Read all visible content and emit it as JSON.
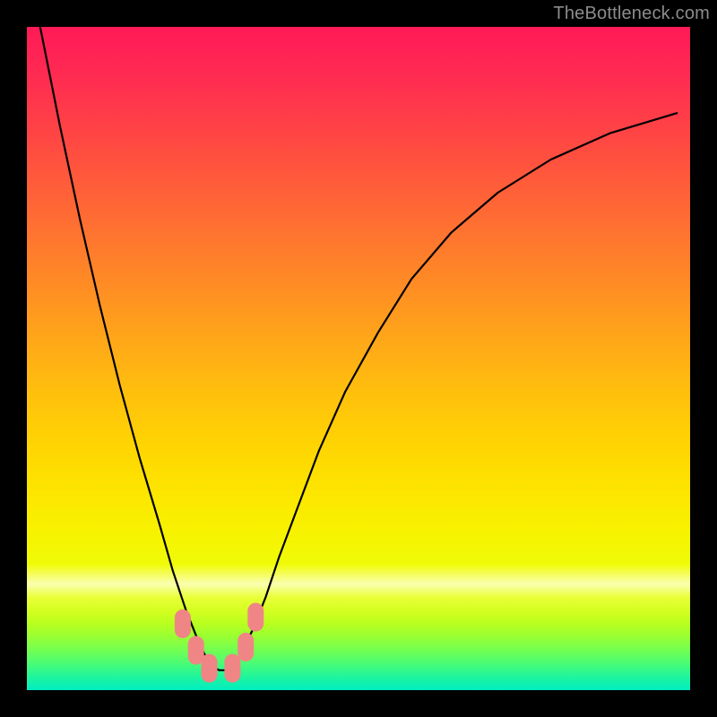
{
  "watermark": {
    "text": "TheBottleneck.com"
  },
  "chart_data": {
    "type": "line",
    "title": "",
    "xlabel": "",
    "ylabel": "",
    "xlim": [
      0,
      100
    ],
    "ylim": [
      0,
      100
    ],
    "grid": false,
    "legend": false,
    "note": "Values estimated from pixel positions; chart has no numeric axes. x and y are normalized 0-100 with y=0 at the bottom (green) and y=100 at the top (red).",
    "series": [
      {
        "name": "bottleneck-curve",
        "x": [
          2,
          5,
          8,
          11,
          14,
          17,
          20,
          22,
          24,
          26,
          27,
          28,
          29,
          30,
          31,
          32,
          34,
          36,
          38,
          41,
          44,
          48,
          53,
          58,
          64,
          71,
          79,
          88,
          98
        ],
        "y": [
          100,
          85,
          71,
          58,
          46,
          35,
          25,
          18,
          12,
          7,
          5,
          3.5,
          3,
          3,
          3.5,
          5,
          9,
          14,
          20,
          28,
          36,
          45,
          54,
          62,
          69,
          75,
          80,
          84,
          87
        ]
      }
    ],
    "markers": [
      {
        "name": "marker-1",
        "x": 23.5,
        "y": 10,
        "color": "#f08585"
      },
      {
        "name": "marker-2",
        "x": 25.5,
        "y": 6,
        "color": "#f08585"
      },
      {
        "name": "marker-3",
        "x": 27.5,
        "y": 3.3,
        "color": "#f08585"
      },
      {
        "name": "marker-4",
        "x": 31.0,
        "y": 3.3,
        "color": "#f08585"
      },
      {
        "name": "marker-5",
        "x": 33.0,
        "y": 6.5,
        "color": "#f08585"
      },
      {
        "name": "marker-6",
        "x": 34.5,
        "y": 11,
        "color": "#f08585"
      }
    ],
    "background_gradient_stops": [
      {
        "pos": 0,
        "hex": "#ff1a57"
      },
      {
        "pos": 50,
        "hex": "#ffae10"
      },
      {
        "pos": 80,
        "hex": "#f5fa05"
      },
      {
        "pos": 100,
        "hex": "#00eec1"
      }
    ]
  }
}
